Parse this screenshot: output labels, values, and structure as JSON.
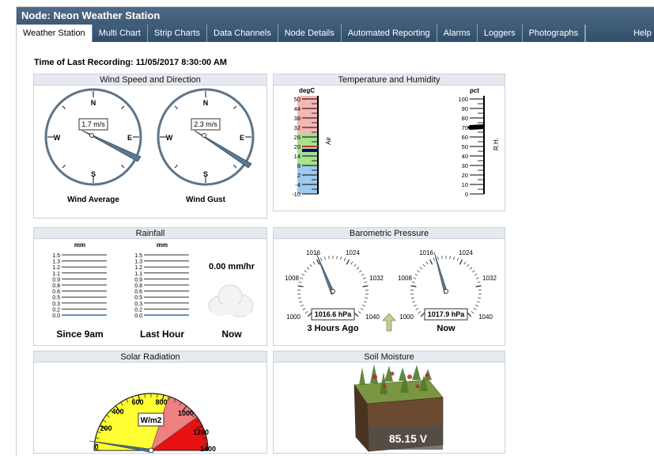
{
  "window": {
    "title": "Node: Neon Weather Station"
  },
  "tabs": [
    {
      "label": "Weather Station",
      "active": true
    },
    {
      "label": "Multi Chart"
    },
    {
      "label": "Strip Charts"
    },
    {
      "label": "Data Channels"
    },
    {
      "label": "Node Details"
    },
    {
      "label": "Automated Reporting"
    },
    {
      "label": "Alarms"
    },
    {
      "label": "Loggers"
    },
    {
      "label": "Photographs"
    },
    {
      "label": "Help"
    }
  ],
  "recording": {
    "text": "Time of Last Recording: 11/05/2017 8:30:00 AM"
  },
  "wind": {
    "title": "Wind Speed and Direction",
    "compass_labels": [
      "N",
      "E",
      "S",
      "W"
    ],
    "gauges": [
      {
        "label": "Wind Average",
        "value": "1.7 m/s"
      },
      {
        "label": "Wind Gust",
        "value": "2.3 m/s"
      }
    ]
  },
  "temp_humidity": {
    "title": "Temperature and Humidity",
    "temp_unit": "degC",
    "temp_ticks": [
      "50",
      "44",
      "38",
      "32",
      "26",
      "20",
      "14",
      "8",
      "2",
      "-4",
      "-10"
    ],
    "temp_series": "Air",
    "humidity_unit": "pct",
    "humidity_ticks": [
      "100",
      "90",
      "80",
      "70",
      "60",
      "50",
      "40",
      "30",
      "20",
      "10",
      "0"
    ],
    "humidity_series": "R.H."
  },
  "rainfall": {
    "title": "Rainfall",
    "unit": "mm",
    "ticks": [
      "1.5",
      "1.3",
      "1.2",
      "1.1",
      "0.9",
      "0.8",
      "0.6",
      "0.5",
      "0.3",
      "0.2",
      "0.0"
    ],
    "since_label": "Since 9am",
    "hour_label": "Last Hour",
    "rate": "0.00 mm/hr",
    "now_label": "Now"
  },
  "pressure": {
    "title": "Barometric Pressure",
    "scale": [
      "1000",
      "1008",
      "1016",
      "1024",
      "1032",
      "1040"
    ],
    "gauges": [
      {
        "label": "3 Hours Ago",
        "value": "1016.6 hPa"
      },
      {
        "label": "Now",
        "value": "1017.9 hPa"
      }
    ]
  },
  "solar": {
    "title": "Solar Radiation",
    "unit": "W/m2",
    "scale": [
      "0",
      "200",
      "400",
      "600",
      "800",
      "1000",
      "1200",
      "1400"
    ],
    "colors": {
      "low": "#ffff33",
      "mid": "#f08080",
      "high": "#e81010"
    }
  },
  "soil": {
    "title": "Soil Moisture",
    "value": "85.15 V"
  }
}
